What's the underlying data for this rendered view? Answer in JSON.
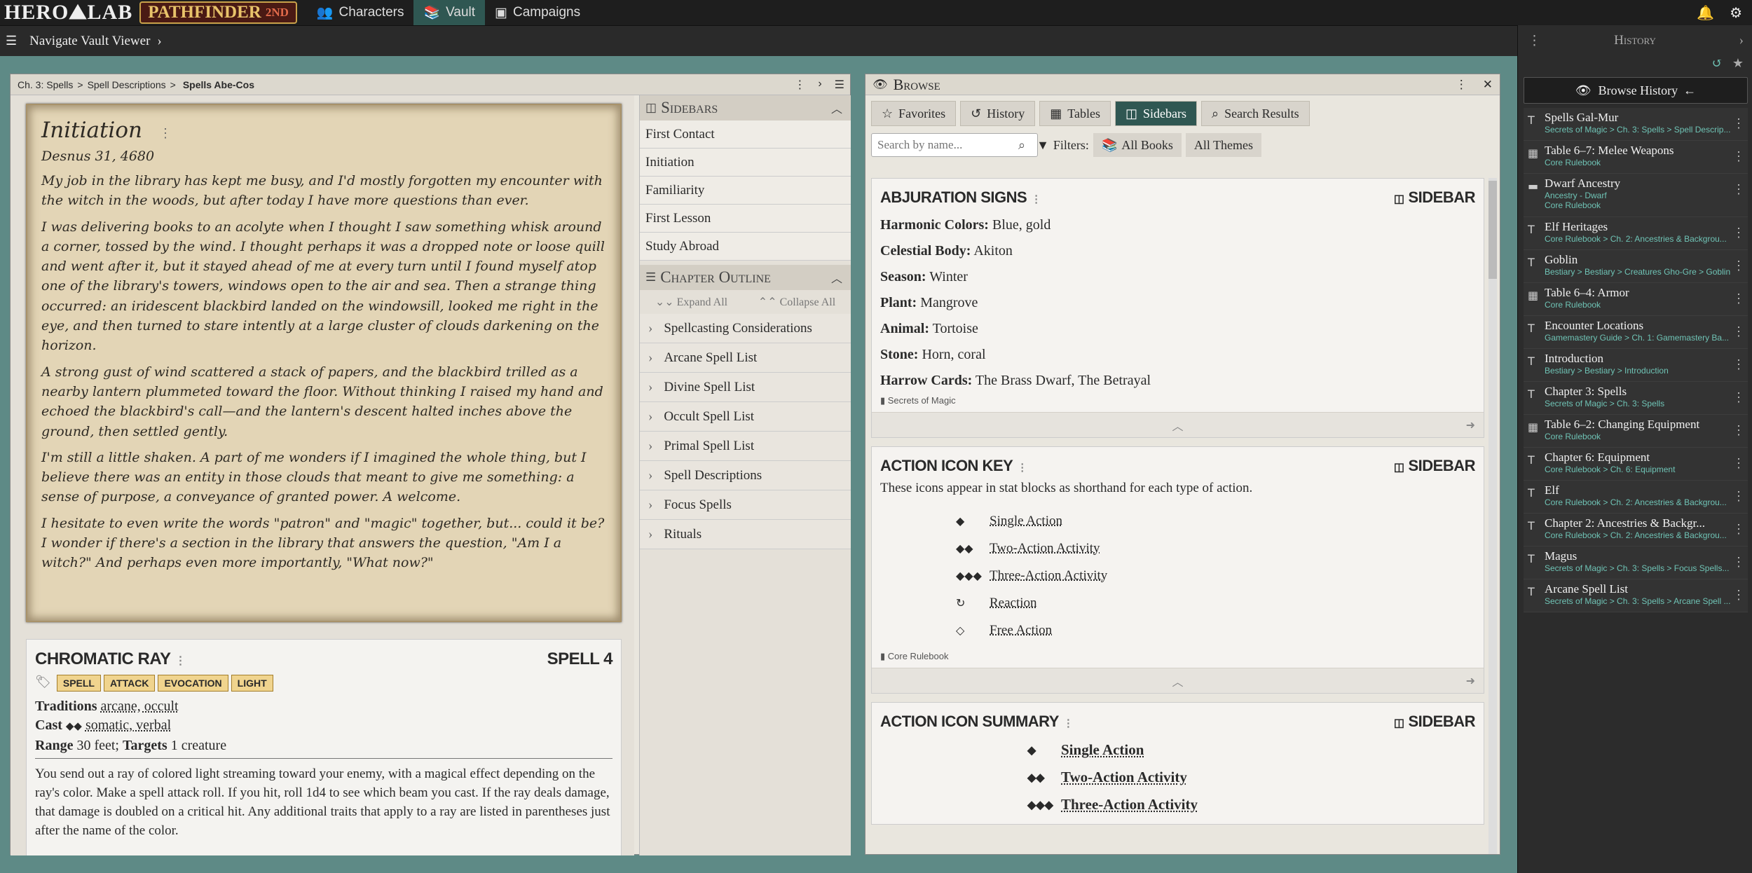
{
  "topbar": {
    "logo": "HERO⛰LAB",
    "game_logo": "PATHFINDER",
    "game_edition": "2ND",
    "tabs": [
      {
        "label": "Characters",
        "icon": "characters-icon"
      },
      {
        "label": "Vault",
        "icon": "vault-icon"
      },
      {
        "label": "Campaigns",
        "icon": "campaigns-icon"
      }
    ]
  },
  "subbar": {
    "label": "Navigate Vault Viewer"
  },
  "history": {
    "header": "History",
    "browse_button": "Browse History",
    "items": [
      {
        "title": "Spells Gal-Mur",
        "sub": "Secrets of Magic > Ch. 3: Spells > Spell Descrip...",
        "icon": "T"
      },
      {
        "title": "Table 6–7: Melee Weapons",
        "sub": "Core Rulebook",
        "icon": "▦"
      },
      {
        "title": "Dwarf Ancestry",
        "sub": "Ancestry - Dwarf",
        "sub2": "Core Rulebook",
        "icon": "▬"
      },
      {
        "title": "Elf Heritages",
        "sub": "Core Rulebook > Ch. 2: Ancestries & Backgrou...",
        "icon": "T"
      },
      {
        "title": "Goblin",
        "sub": "Bestiary > Bestiary > Creatures Gho-Gre > Goblin",
        "icon": "T"
      },
      {
        "title": "Table 6–4: Armor",
        "sub": "Core Rulebook",
        "icon": "▦"
      },
      {
        "title": "Encounter Locations",
        "sub": "Gamemastery Guide > Ch. 1: Gamemastery Ba...",
        "icon": "T"
      },
      {
        "title": "Introduction",
        "sub": "Bestiary > Bestiary > Introduction",
        "icon": "T"
      },
      {
        "title": "Chapter 3: Spells",
        "sub": "Secrets of Magic > Ch. 3: Spells",
        "icon": "T"
      },
      {
        "title": "Table 6–2: Changing Equipment",
        "sub": "Core Rulebook",
        "icon": "▦"
      },
      {
        "title": "Chapter 6: Equipment",
        "sub": "Core Rulebook > Ch. 6: Equipment",
        "icon": "T"
      },
      {
        "title": "Elf",
        "sub": "Core Rulebook > Ch. 2: Ancestries & Backgrou...",
        "icon": "T"
      },
      {
        "title": "Chapter 2: Ancestries & Backgr...",
        "sub": "Core Rulebook > Ch. 2: Ancestries & Backgrou...",
        "icon": "T"
      },
      {
        "title": "Magus",
        "sub": "Secrets of Magic > Ch. 3: Spells > Focus Spells...",
        "icon": "T"
      },
      {
        "title": "Arcane Spell List",
        "sub": "Secrets of Magic > Ch. 3: Spells > Arcane Spell ...",
        "icon": "T"
      }
    ]
  },
  "reader": {
    "breadcrumb": [
      "Ch. 3: Spells",
      "Spell Descriptions"
    ],
    "breadcrumb_current": "Spells Abe-Cos",
    "journal": {
      "title": "Initiation",
      "date": "Desnus 31, 4680",
      "paragraphs": [
        "My job in the library has kept me busy, and I'd mostly forgotten my encounter with the witch in the woods, but after today I have more questions than ever.",
        "I was delivering books to an acolyte when I thought I saw something whisk around a corner, tossed by the wind. I thought perhaps it was a dropped note or loose quill and went after it, but it stayed ahead of me at every turn until I found myself atop one of the library's towers, windows open to the air and sea. Then a strange thing occurred: an iridescent blackbird landed on the windowsill, looked me right in the eye, and then turned to stare intently at a large cluster of clouds darkening on the horizon.",
        "A strong gust of wind scattered a stack of papers, and the blackbird trilled as a nearby lantern plummeted toward the floor. Without thinking I raised my hand and echoed the blackbird's call—and the lantern's descent halted inches above the ground, then settled gently.",
        "I'm still a little shaken. A part of me wonders if I imagined the whole thing, but I believe there was an entity in those clouds that meant to give me something: a sense of purpose, a conveyance of granted power. A welcome.",
        "I hesitate to even write the words \"patron\" and \"magic\" together, but... could it be? I wonder if there's a section in the library that answers the question, \"Am I a witch?\" And perhaps even more importantly, \"What now?\""
      ]
    },
    "spell": {
      "name": "CHROMATIC RAY",
      "level": "SPELL 4",
      "traits": [
        "SPELL",
        "ATTACK",
        "EVOCATION",
        "LIGHT"
      ],
      "traditions_label": "Traditions",
      "traditions": "arcane, occult",
      "cast_label": "Cast",
      "cast": "somatic, verbal",
      "range_label": "Range",
      "range": "30 feet;",
      "targets_label": "Targets",
      "targets": "1 creature",
      "description": "You send out a ray of colored light streaming toward your enemy, with a magical effect depending on the ray's color. Make a spell attack roll. If you hit, roll 1d4 to see which beam you cast. If the ray deals damage, that damage is doubled on a critical hit. Any additional traits that apply to a ray are listed in parentheses just after the name of the color."
    },
    "sidebars": {
      "header": "Sidebars",
      "items": [
        "First Contact",
        "Initiation",
        "Familiarity",
        "First Lesson",
        "Study Abroad"
      ]
    },
    "outline": {
      "header": "Chapter Outline",
      "expand_all": "Expand All",
      "collapse_all": "Collapse All",
      "items": [
        "Spellcasting Considerations",
        "Arcane Spell List",
        "Divine Spell List",
        "Occult Spell List",
        "Primal Spell List",
        "Spell Descriptions",
        "Focus Spells",
        "Rituals"
      ]
    }
  },
  "browse": {
    "title": "Browse",
    "tabs": [
      {
        "label": "Favorites",
        "icon": "☆"
      },
      {
        "label": "History",
        "icon": "↺"
      },
      {
        "label": "Tables",
        "icon": "▦"
      },
      {
        "label": "Sidebars",
        "icon": "◫"
      },
      {
        "label": "Search Results",
        "icon": "⌕"
      }
    ],
    "search_placeholder": "Search by name...",
    "filters_label": "Filters:",
    "all_books": "All Books",
    "all_themes": "All Themes",
    "cards": {
      "abjuration": {
        "title": "ABJURATION SIGNS",
        "kind": "SIDEBAR",
        "rows": [
          {
            "label": "Harmonic Colors:",
            "value": "Blue, gold"
          },
          {
            "label": "Celestial Body:",
            "value": "Akiton"
          },
          {
            "label": "Season:",
            "value": "Winter"
          },
          {
            "label": "Plant:",
            "value": "Mangrove"
          },
          {
            "label": "Animal:",
            "value": "Tortoise"
          },
          {
            "label": "Stone:",
            "value": "Horn, coral"
          },
          {
            "label": "Harrow Cards:",
            "value": "The Brass Dwarf, The Betrayal"
          }
        ],
        "source": "Secrets of Magic"
      },
      "iconkey": {
        "title": "ACTION ICON KEY",
        "kind": "SIDEBAR",
        "intro": "These icons appear in stat blocks as shorthand for each type of action.",
        "actions": [
          {
            "glyph": "◆",
            "label": "Single Action"
          },
          {
            "glyph": "◆◆",
            "label": "Two-Action Activity"
          },
          {
            "glyph": "◆◆◆",
            "label": "Three-Action Activity"
          },
          {
            "glyph": "↻",
            "label": "Reaction"
          },
          {
            "glyph": "◇",
            "label": "Free Action"
          }
        ],
        "source": "Core Rulebook"
      },
      "summary": {
        "title": "ACTION ICON SUMMARY",
        "kind": "SIDEBAR",
        "actions": [
          {
            "glyph": "◆",
            "label": "Single Action"
          },
          {
            "glyph": "◆◆",
            "label": "Two-Action Activity"
          },
          {
            "glyph": "◆◆◆",
            "label": "Three-Action Activity"
          }
        ]
      }
    }
  }
}
